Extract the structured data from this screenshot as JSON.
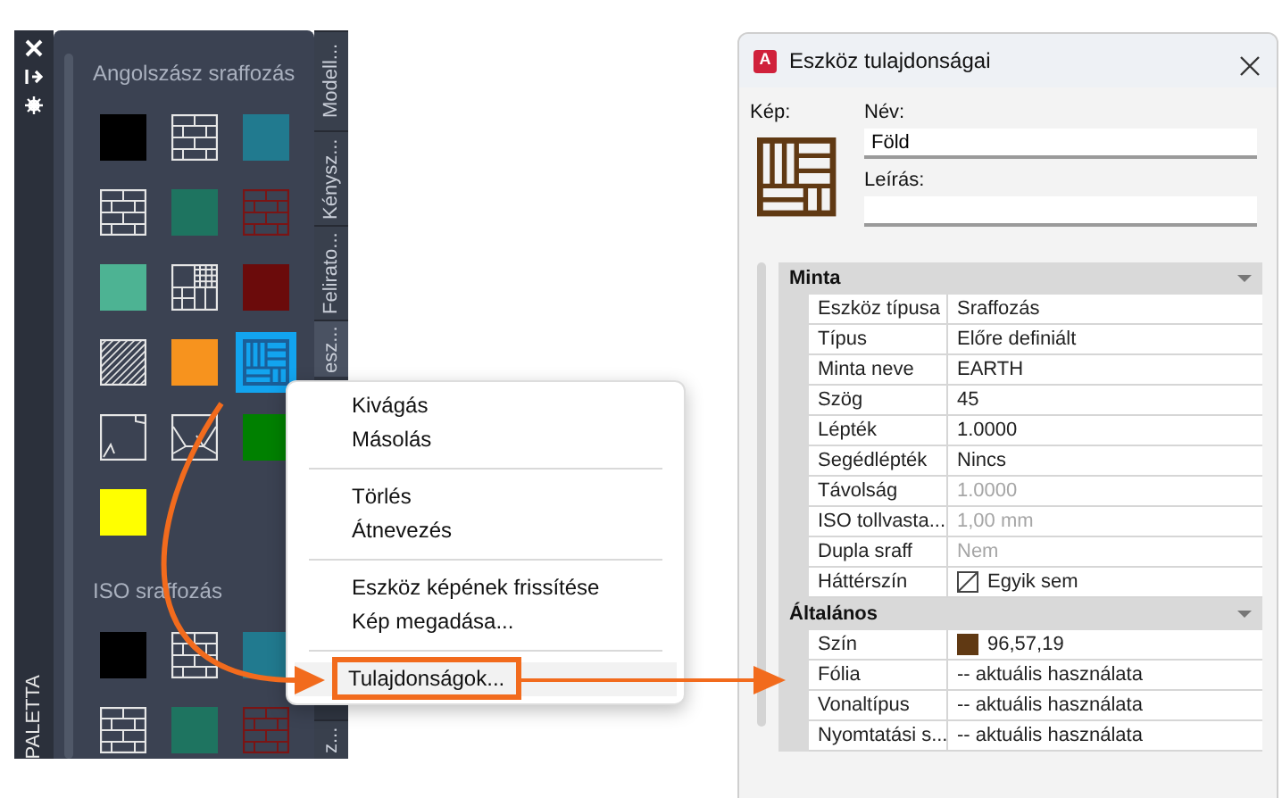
{
  "palette": {
    "vertical_title": "PALETTA",
    "side_tabs": [
      {
        "label": "Modell...",
        "selected": false
      },
      {
        "label": "Kénysz...",
        "selected": false
      },
      {
        "label": "Felirato...",
        "selected": false
      },
      {
        "label": "esz...",
        "selected": true
      },
      {
        "label": "z...",
        "selected": false
      }
    ],
    "groups": [
      {
        "title": "Angolszász sraffozás",
        "tiles": [
          {
            "kind": "solid",
            "color": "#000000",
            "selected": false
          },
          {
            "kind": "brick",
            "color": "#e6e6e6",
            "selected": false
          },
          {
            "kind": "solid",
            "color": "#217a8f",
            "selected": false
          },
          {
            "kind": "brick",
            "color": "#e6e6e6",
            "selected": false
          },
          {
            "kind": "solid",
            "color": "#1e7460",
            "selected": false
          },
          {
            "kind": "brick",
            "color": "#7a1414",
            "selected": false
          },
          {
            "kind": "solid",
            "color": "#4db393",
            "selected": false
          },
          {
            "kind": "grid",
            "color": "#e6e6e6",
            "selected": false
          },
          {
            "kind": "solid",
            "color": "#6b0b0b",
            "selected": false
          },
          {
            "kind": "diagonal",
            "color": "#e6e6e6",
            "selected": false
          },
          {
            "kind": "solid",
            "color": "#f7931e",
            "selected": false
          },
          {
            "kind": "parquet",
            "color": "#1a5f99",
            "selected": true
          },
          {
            "kind": "corner",
            "color": "#e6e6e6",
            "selected": false
          },
          {
            "kind": "star",
            "color": "#e6e6e6",
            "selected": false
          },
          {
            "kind": "solid",
            "color": "#008000",
            "selected": false
          },
          {
            "kind": "solid",
            "color": "#ffff00",
            "selected": false
          }
        ]
      },
      {
        "title": "ISO sraffozás",
        "tiles": [
          {
            "kind": "solid",
            "color": "#000000",
            "selected": false
          },
          {
            "kind": "brick",
            "color": "#e6e6e6",
            "selected": false
          },
          {
            "kind": "solid",
            "color": "#217a8f",
            "selected": false
          },
          {
            "kind": "brick",
            "color": "#e6e6e6",
            "selected": false
          },
          {
            "kind": "solid",
            "color": "#1e7460",
            "selected": false
          },
          {
            "kind": "brick",
            "color": "#7a1414",
            "selected": false
          }
        ]
      }
    ]
  },
  "context_menu": {
    "groups": [
      [
        {
          "label": "Kivágás",
          "selected": false
        },
        {
          "label": "Másolás",
          "selected": false
        }
      ],
      [
        {
          "label": "Törlés",
          "selected": false
        },
        {
          "label": "Átnevezés",
          "selected": false
        }
      ],
      [
        {
          "label": "Eszköz képének frissítése",
          "selected": false
        },
        {
          "label": "Kép megadása...",
          "selected": false
        }
      ],
      [
        {
          "label": "Tulajdonságok...",
          "selected": true
        }
      ]
    ]
  },
  "dialog": {
    "icon_text": "A",
    "title": "Eszköz tulajdonságai",
    "image_label": "Kép:",
    "name_label": "Név:",
    "name_value": "Föld",
    "description_label": "Leírás:",
    "sections": [
      {
        "title": "Minta",
        "expanded": true,
        "rows": [
          {
            "label": "Eszköz típusa",
            "value": "Sraffozás",
            "kind": "text",
            "disabled": false
          },
          {
            "label": "Típus",
            "value": "Előre definiált",
            "kind": "text",
            "disabled": false
          },
          {
            "label": "Minta neve",
            "value": "EARTH",
            "kind": "text",
            "disabled": false
          },
          {
            "label": "Szög",
            "value": "45",
            "kind": "text",
            "disabled": false
          },
          {
            "label": "Lépték",
            "value": "1.0000",
            "kind": "text",
            "disabled": false
          },
          {
            "label": "Segédlépték",
            "value": "Nincs",
            "kind": "text",
            "disabled": false
          },
          {
            "label": "Távolság",
            "value": "1.0000",
            "kind": "text",
            "disabled": true
          },
          {
            "label": "ISO tollvasta...",
            "value": "1,00 mm",
            "kind": "text",
            "disabled": true
          },
          {
            "label": "Dupla sraff",
            "value": "Nem",
            "kind": "text",
            "disabled": true
          },
          {
            "label": "Háttérszín",
            "value": "Egyik sem",
            "kind": "no-color",
            "disabled": false
          }
        ]
      },
      {
        "title": "Általános",
        "expanded": true,
        "rows": [
          {
            "label": "Szín",
            "value": "96,57,19",
            "kind": "swatch",
            "color": "#603913",
            "disabled": false
          },
          {
            "label": "Fólia",
            "value": "-- aktuális használata",
            "kind": "text",
            "disabled": false
          },
          {
            "label": "Vonaltípus",
            "value": "-- aktuális használata",
            "kind": "text",
            "disabled": false
          },
          {
            "label": "Nyomtatási s...",
            "value": "-- aktuális használata",
            "kind": "text",
            "disabled": false
          }
        ]
      }
    ]
  }
}
